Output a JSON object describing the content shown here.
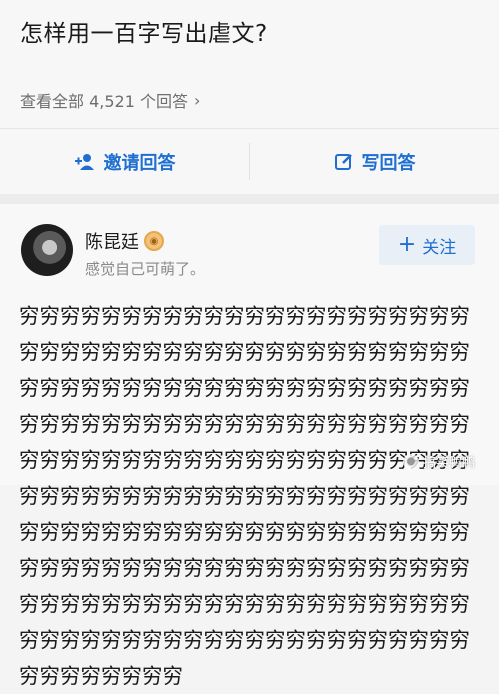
{
  "question": {
    "title": "怎样用一百字写出虐文?",
    "view_all": "查看全部 4,521 个回答"
  },
  "actions": {
    "invite": "邀请回答",
    "write": "写回答"
  },
  "answer": {
    "author": "陈昆廷",
    "bio": "感觉自己可萌了。",
    "follow": "关注",
    "content": "穷穷穷穷穷穷穷穷穷穷穷穷穷穷穷穷穷穷穷穷穷穷穷穷穷穷穷穷穷穷穷穷穷穷穷穷穷穷穷穷穷穷穷穷穷穷穷穷穷穷穷穷穷穷穷穷穷穷穷穷穷穷穷穷穷穷穷穷穷穷穷穷穷穷穷穷穷穷穷穷穷穷穷穷穷穷穷穷穷穷穷穷穷穷穷穷穷穷穷穷穷穷穷穷穷穷穷穷穷穷穷穷穷穷穷穷穷穷穷穷穷穷穷穷穷穷穷穷穷穷穷穷穷穷穷穷穷穷穷穷穷穷穷穷穷穷穷穷穷穷穷穷穷穷穷穷穷穷穷穷穷穷穷穷穷穷穷穷穷穷穷穷穷穷穷穷穷穷穷穷穷穷穷穷穷穷穷穷穷穷穷穷穷穷穷穷穷穷穷穷穷穷穷穷穷穷穷穷穷穷穷穷穷穷穷穷穷穷穷穷穷穷穷穷穷穷穷穷"
  },
  "watermark": "搞笑鸭鸭",
  "colors": {
    "accent": "#1e6fd0"
  }
}
